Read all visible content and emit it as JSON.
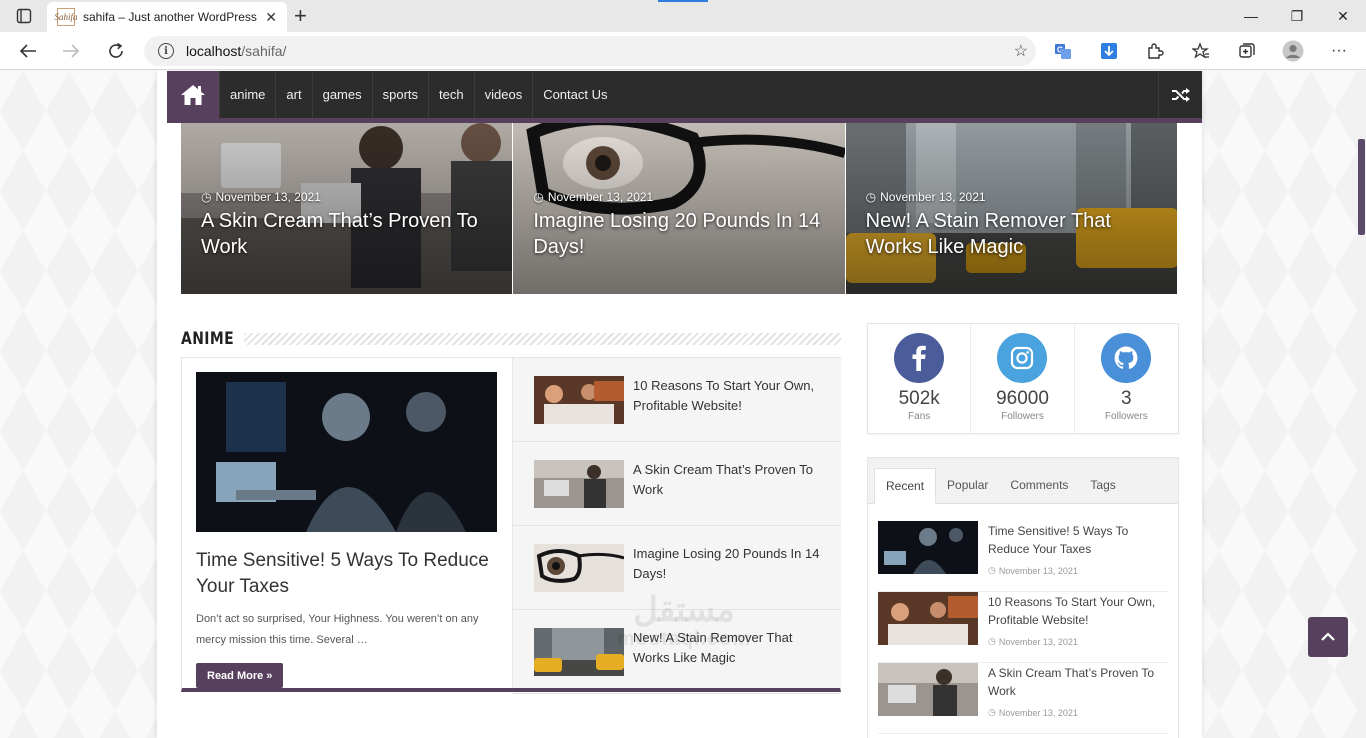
{
  "browser": {
    "tab_title": "sahifa – Just another WordPress s",
    "favicon_text": "Sahifa",
    "url_host": "localhost",
    "url_path": "/sahifa/"
  },
  "nav": {
    "items": [
      "anime",
      "art",
      "games",
      "sports",
      "tech",
      "videos",
      "Contact Us"
    ]
  },
  "slider": [
    {
      "date": "November 13, 2021",
      "title": "A Skin Cream That’s Proven To Work"
    },
    {
      "date": "November 13, 2021",
      "title": "Imagine Losing 20 Pounds In 14 Days!"
    },
    {
      "date": "November 13, 2021",
      "title": "New! A Stain Remover That Works Like Magic"
    }
  ],
  "anime_block": {
    "heading": "ANIME",
    "feature": {
      "title": "Time Sensitive! 5 Ways To Reduce Your Taxes",
      "excerpt": "Don’t act so surprised, Your Highness. You weren’t on any mercy mission this time. Several …",
      "read_more": "Read More »"
    },
    "list": [
      {
        "title": "10 Reasons To Start Your Own, Profitable Website!"
      },
      {
        "title": "A Skin Cream That’s Proven To Work"
      },
      {
        "title": "Imagine Losing 20 Pounds In 14 Days!"
      },
      {
        "title": "New! A Stain Remover That Works Like Magic"
      }
    ]
  },
  "social": [
    {
      "network": "facebook-icon",
      "count": "502k",
      "label": "Fans",
      "color": "#4a5d9a"
    },
    {
      "network": "instagram-icon",
      "count": "96000",
      "label": "Followers",
      "color": "#4aa3df"
    },
    {
      "network": "github-icon",
      "count": "3",
      "label": "Followers",
      "color": "#4a90d9"
    }
  ],
  "tabs_widget": {
    "tabs": [
      "Recent",
      "Popular",
      "Comments",
      "Tags"
    ],
    "recent": [
      {
        "title": "Time Sensitive! 5 Ways To Reduce Your Taxes",
        "date": "November 13, 2021"
      },
      {
        "title": "10 Reasons To Start Your Own, Profitable Website!",
        "date": "November 13, 2021"
      },
      {
        "title": "A Skin Cream That’s Proven To Work",
        "date": "November 13, 2021"
      }
    ]
  },
  "watermark": {
    "line1": "مستقل",
    "line2": "mostaql.com"
  },
  "colors": {
    "accent": "#57405d",
    "nav_bg": "#2c2c2c"
  }
}
